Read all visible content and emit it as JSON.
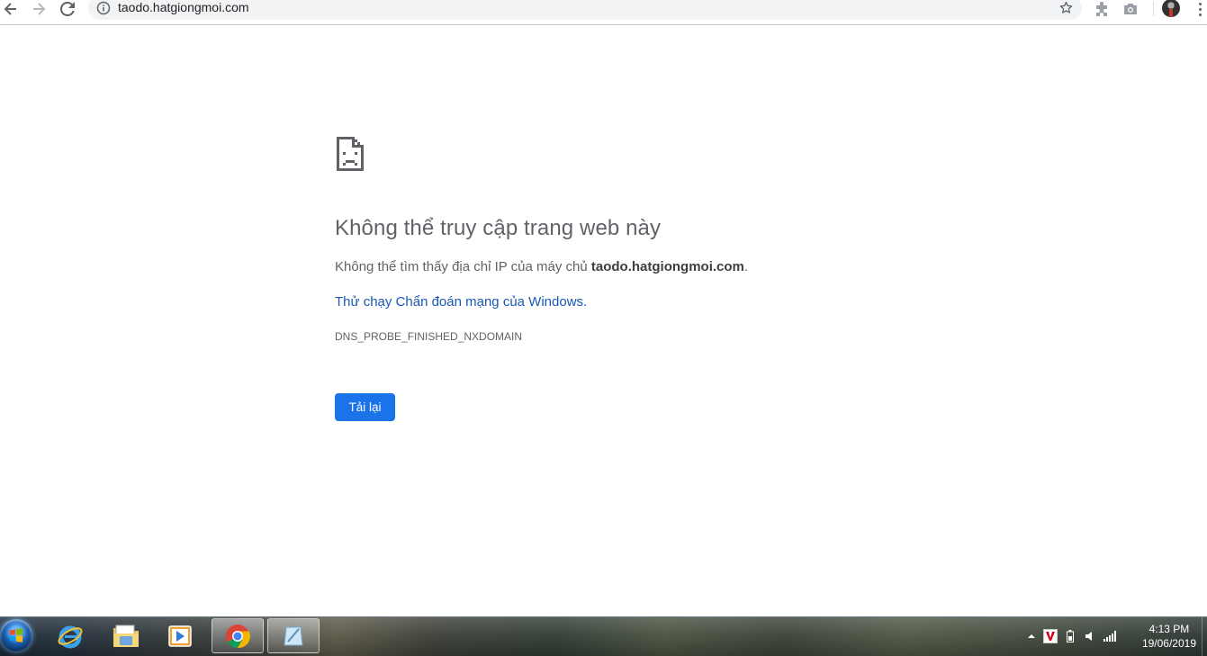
{
  "browser": {
    "url": "taodo.hatgiongmoi.com"
  },
  "error_page": {
    "title": "Không thể truy cập trang web này",
    "detail_prefix": "Không thể tìm thấy địa chỉ IP của máy chủ ",
    "detail_host": "taodo.hatgiongmoi.com",
    "detail_suffix": ".",
    "diagnostics_link": "Thử chạy Chẩn đoán mạng của Windows.",
    "error_code": "DNS_PROBE_FINISHED_NXDOMAIN",
    "reload_label": "Tải lại"
  },
  "taskbar": {
    "pinned": [
      {
        "name": "internet-explorer",
        "icon": "ie-icon"
      },
      {
        "name": "file-explorer",
        "icon": "folder-icon"
      },
      {
        "name": "media-player",
        "icon": "media-player-icon"
      },
      {
        "name": "google-chrome",
        "icon": "chrome-icon",
        "active": true
      },
      {
        "name": "notes-app",
        "icon": "notes-icon"
      }
    ],
    "clock_time": "4:13 PM",
    "clock_date": "19/06/2019"
  },
  "colors": {
    "accent_button": "#1a73e8",
    "link": "#1a57b8",
    "text_muted": "#5f6368"
  }
}
